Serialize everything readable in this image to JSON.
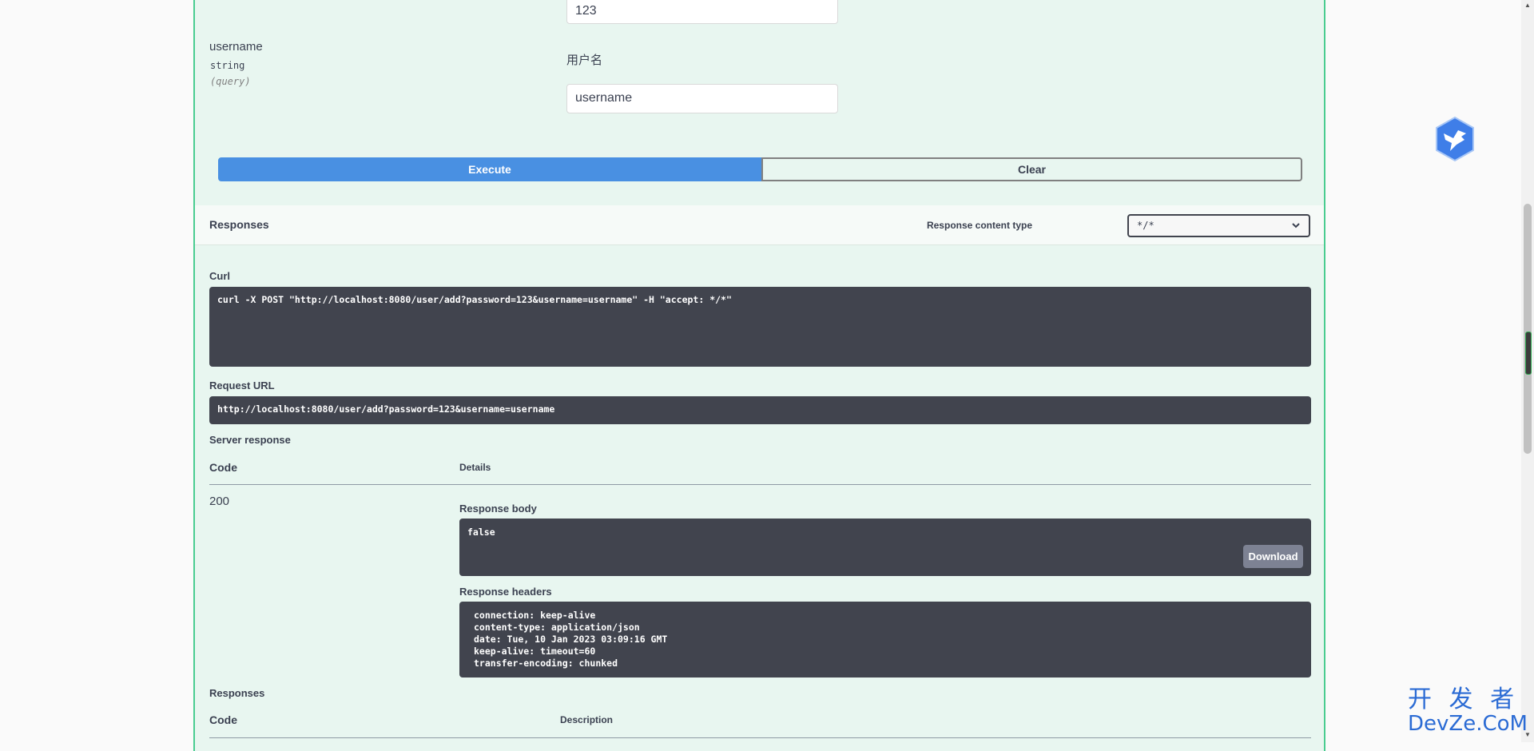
{
  "params": [
    {
      "value": "123"
    },
    {
      "name": "username",
      "type": "string",
      "in": "(query)",
      "description": "用户名",
      "value": "username"
    }
  ],
  "buttons": {
    "execute": "Execute",
    "clear": "Clear"
  },
  "responses_header": {
    "title": "Responses",
    "content_type_label": "Response content type",
    "content_type_value": "*/*"
  },
  "curl": {
    "label": "Curl",
    "command": "curl -X POST \"http://localhost:8080/user/add?password=123&username=username\" -H \"accept: */*\""
  },
  "request_url": {
    "label": "Request URL",
    "value": "http://localhost:8080/user/add?password=123&username=username"
  },
  "server_response": {
    "label": "Server response",
    "col_code": "Code",
    "col_details": "Details",
    "code": "200",
    "body_label": "Response body",
    "body": "false",
    "download": "Download",
    "headers_label": "Response headers",
    "headers": [
      "connection: keep-alive",
      "content-type: application/json",
      "date: Tue, 10 Jan 2023 03:09:16 GMT",
      "keep-alive: timeout=60",
      "transfer-encoding: chunked"
    ]
  },
  "responses_table": {
    "title": "Responses",
    "col_code": "Code",
    "col_description": "Description"
  },
  "watermark": {
    "line1": "开 发 者",
    "line2": "DevZe.CoM"
  },
  "colors": {
    "execute": "#4990e2",
    "border": "#49cc90",
    "code_bg": "#41444e"
  },
  "icons": {
    "badge": "hummingbird-icon",
    "select": "chevron-down-icon"
  }
}
